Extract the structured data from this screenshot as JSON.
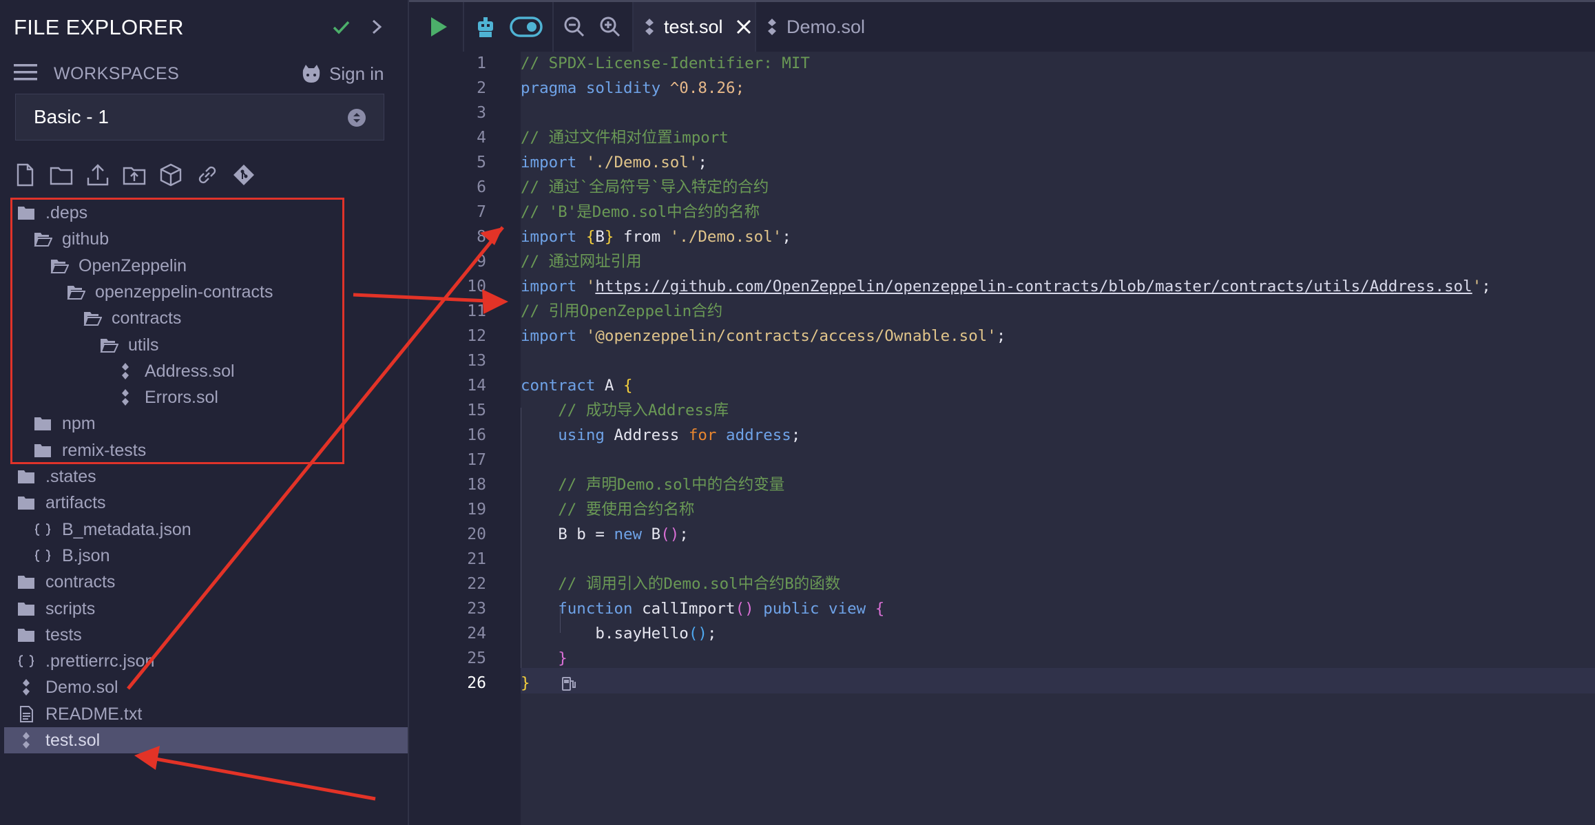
{
  "sidebar": {
    "title": "FILE EXPLORER",
    "workspaces_label": "WORKSPACES",
    "signin_label": "Sign in",
    "workspace_selected": "Basic - 1",
    "tree": [
      {
        "label": ".deps",
        "type": "folder",
        "depth": 0
      },
      {
        "label": "github",
        "type": "folder-open",
        "depth": 1
      },
      {
        "label": "OpenZeppelin",
        "type": "folder-open",
        "depth": 2
      },
      {
        "label": "openzeppelin-contracts",
        "type": "folder-open",
        "depth": 3
      },
      {
        "label": "contracts",
        "type": "folder-open",
        "depth": 4
      },
      {
        "label": "utils",
        "type": "folder-open",
        "depth": 5
      },
      {
        "label": "Address.sol",
        "type": "sol",
        "depth": 6
      },
      {
        "label": "Errors.sol",
        "type": "sol",
        "depth": 6
      },
      {
        "label": "npm",
        "type": "folder",
        "depth": 1
      },
      {
        "label": "remix-tests",
        "type": "folder",
        "depth": 1
      },
      {
        "label": ".states",
        "type": "folder",
        "depth": 0
      },
      {
        "label": "artifacts",
        "type": "folder",
        "depth": 0
      },
      {
        "label": "B_metadata.json",
        "type": "json",
        "depth": 1
      },
      {
        "label": "B.json",
        "type": "json",
        "depth": 1
      },
      {
        "label": "contracts",
        "type": "folder",
        "depth": 0
      },
      {
        "label": "scripts",
        "type": "folder",
        "depth": 0
      },
      {
        "label": "tests",
        "type": "folder",
        "depth": 0
      },
      {
        "label": ".prettierrc.json",
        "type": "json",
        "depth": 0
      },
      {
        "label": "Demo.sol",
        "type": "sol",
        "depth": 0
      },
      {
        "label": "README.txt",
        "type": "txt",
        "depth": 0
      },
      {
        "label": "test.sol",
        "type": "sol",
        "depth": 0,
        "selected": true
      }
    ]
  },
  "editor": {
    "tabs": [
      {
        "label": "test.sol",
        "active": true
      },
      {
        "label": "Demo.sol",
        "active": false
      }
    ],
    "current_line": 26,
    "code": {
      "l1": "// SPDX-License-Identifier: MIT",
      "l2_kw": "pragma solidity",
      "l2_ver": " ^0.8.26;",
      "l4": "// 通过文件相对位置import",
      "l5_kw": "import",
      "l5_str": "'./Demo.sol'",
      "l6": "// 通过`全局符号`导入特定的合约",
      "l7": "// 'B'是Demo.sol中合约的名称",
      "l8_kw": "import",
      "l8_b": "B",
      "l8_from": " from ",
      "l8_str": "'./Demo.sol'",
      "l9": "// 通过网址引用",
      "l10_kw": "import",
      "l10_url": "https://github.com/OpenZeppelin/openzeppelin-contracts/blob/master/contracts/utils/Address.sol",
      "l11": "// 引用OpenZeppelin合约",
      "l12_kw": "import",
      "l12_str": "'@openzeppelin/contracts/access/Ownable.sol'",
      "l14_kw": "contract",
      "l14_name": " A ",
      "l15": "// 成功导入Address库",
      "l16_using": "using",
      "l16_addr": " Address ",
      "l16_for": "for",
      "l16_type": "address",
      "l18": "// 声明Demo.sol中的合约变量",
      "l19": "// 要使用合约名称",
      "l20_a": "B b = ",
      "l20_new": "new",
      "l20_b": " B",
      "l22": "// 调用引入的Demo.sol中合约B的函数",
      "l23_fn": "function",
      "l23_name": " callImport",
      "l23_pub": "public",
      "l23_view": "view",
      "l24": "b.sayHello"
    }
  },
  "colors": {
    "background": "#222336",
    "editor_bg": "#2a2c3f",
    "comment": "#6a9955",
    "keyword": "#6fa3e8",
    "annotation": "#e0332a",
    "accent_green": "#4caf6a"
  }
}
